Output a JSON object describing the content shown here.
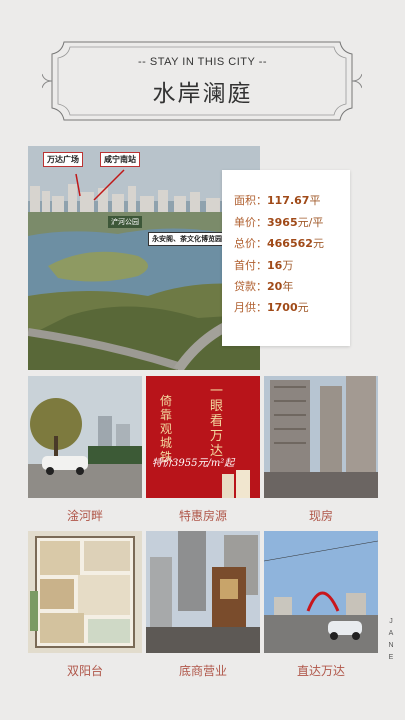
{
  "header": {
    "subtitle": "-- STAY IN THIS CITY --",
    "title": "水岸澜庭"
  },
  "main_photo": {
    "callouts": {
      "wanda": "万达广场",
      "station": "咸宁南站",
      "park": "浐河公园",
      "culture": "永安阁、茶文化博览园"
    }
  },
  "info": {
    "rows": [
      {
        "label": "面积：",
        "value": "117.67",
        "unit": "平"
      },
      {
        "label": "单价：",
        "value": "3965",
        "unit": "元/平"
      },
      {
        "label": "总价：",
        "value": "466562",
        "unit": "元"
      },
      {
        "label": "首付：",
        "value": "16",
        "unit": "万"
      },
      {
        "label": "贷款：",
        "value": "20",
        "unit": "年"
      },
      {
        "label": "月供：",
        "value": "1700",
        "unit": "元"
      }
    ]
  },
  "promo": {
    "line1": "一眼看万达",
    "line2": "倚靠观城铁",
    "price": "特价3955元/m²起"
  },
  "tiles": [
    {
      "caption": "淦河畔"
    },
    {
      "caption": "特惠房源"
    },
    {
      "caption": "现房"
    },
    {
      "caption": "双阳台"
    },
    {
      "caption": "底商营业"
    },
    {
      "caption": "直达万达"
    }
  ],
  "side_label": "JANE",
  "colors": {
    "accent": "#b0574a",
    "price": "#a04a18",
    "promo_bg": "#b8141a"
  }
}
